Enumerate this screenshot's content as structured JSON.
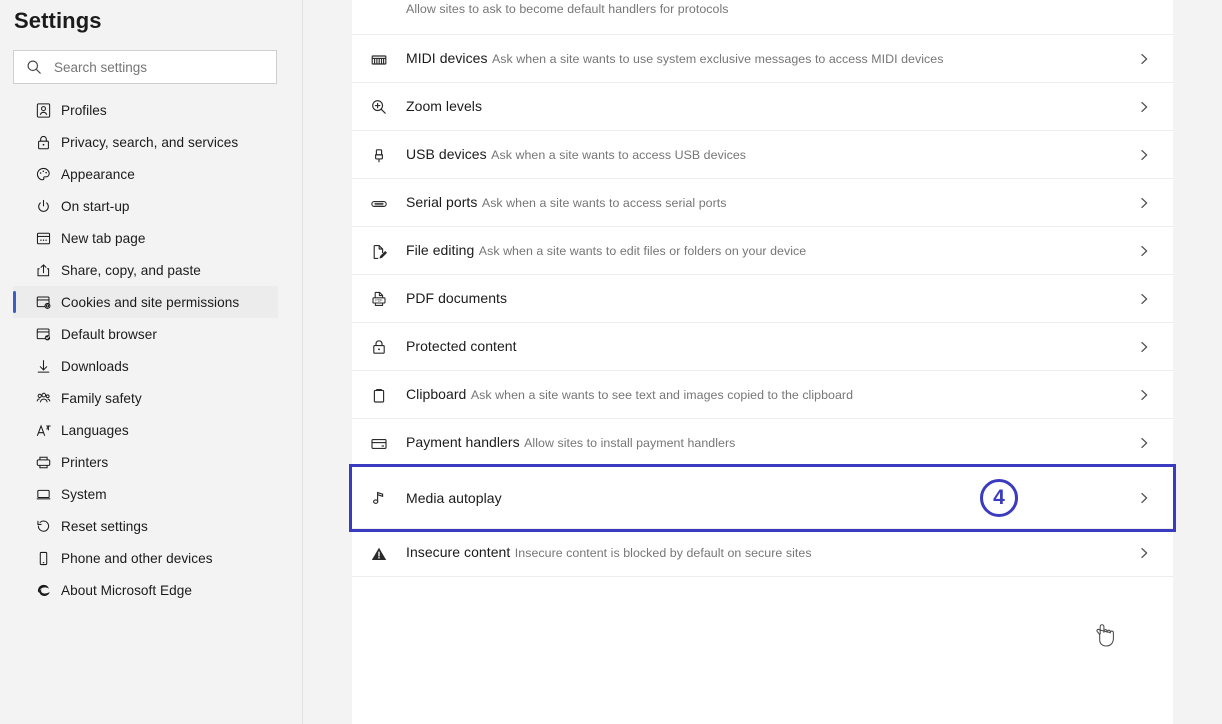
{
  "sidebar": {
    "title": "Settings",
    "search": {
      "placeholder": "Search settings",
      "value": "",
      "icon": "search-icon"
    },
    "items": [
      {
        "label": "Profiles",
        "icon": "profile-icon",
        "selected": false
      },
      {
        "label": "Privacy, search, and services",
        "icon": "lock-icon",
        "selected": false
      },
      {
        "label": "Appearance",
        "icon": "palette-icon",
        "selected": false
      },
      {
        "label": "On start-up",
        "icon": "power-icon",
        "selected": false
      },
      {
        "label": "New tab page",
        "icon": "new-tab-icon",
        "selected": false
      },
      {
        "label": "Share, copy, and paste",
        "icon": "share-icon",
        "selected": false
      },
      {
        "label": "Cookies and site permissions",
        "icon": "cookies-icon",
        "selected": true
      },
      {
        "label": "Default browser",
        "icon": "default-browser-icon",
        "selected": false
      },
      {
        "label": "Downloads",
        "icon": "download-icon",
        "selected": false
      },
      {
        "label": "Family safety",
        "icon": "family-icon",
        "selected": false
      },
      {
        "label": "Languages",
        "icon": "languages-icon",
        "selected": false
      },
      {
        "label": "Printers",
        "icon": "printer-icon",
        "selected": false
      },
      {
        "label": "System",
        "icon": "system-icon",
        "selected": false
      },
      {
        "label": "Reset settings",
        "icon": "reset-icon",
        "selected": false
      },
      {
        "label": "Phone and other devices",
        "icon": "phone-icon",
        "selected": false
      },
      {
        "label": "About Microsoft Edge",
        "icon": "edge-logo-icon",
        "selected": false
      }
    ]
  },
  "main": {
    "rows": [
      {
        "title": "",
        "subtitle": "Allow sites to ask to become default handlers for protocols",
        "icon": "protocol-handlers-icon",
        "chevron": false,
        "partial": true,
        "highlighted": false
      },
      {
        "title": "MIDI devices",
        "subtitle": "Ask when a site wants to use system exclusive messages to access MIDI devices",
        "icon": "midi-keyboard-icon",
        "chevron": true,
        "partial": false,
        "highlighted": false
      },
      {
        "title": "Zoom levels",
        "subtitle": "",
        "icon": "zoom-in-icon",
        "chevron": true,
        "partial": false,
        "highlighted": false
      },
      {
        "title": "USB devices",
        "subtitle": "Ask when a site wants to access USB devices",
        "icon": "usb-icon",
        "chevron": true,
        "partial": false,
        "highlighted": false
      },
      {
        "title": "Serial ports",
        "subtitle": "Ask when a site wants to access serial ports",
        "icon": "serial-port-icon",
        "chevron": true,
        "partial": false,
        "highlighted": false
      },
      {
        "title": "File editing",
        "subtitle": "Ask when a site wants to edit files or folders on your device",
        "icon": "file-edit-icon",
        "chevron": true,
        "partial": false,
        "highlighted": false
      },
      {
        "title": "PDF documents",
        "subtitle": "",
        "icon": "pdf-document-icon",
        "chevron": true,
        "partial": false,
        "highlighted": false
      },
      {
        "title": "Protected content",
        "subtitle": "",
        "icon": "padlock-icon",
        "chevron": true,
        "partial": false,
        "highlighted": false
      },
      {
        "title": "Clipboard",
        "subtitle": "Ask when a site wants to see text and images copied to the clipboard",
        "icon": "clipboard-icon",
        "chevron": true,
        "partial": false,
        "highlighted": false
      },
      {
        "title": "Payment handlers",
        "subtitle": "Allow sites to install payment handlers",
        "icon": "payment-card-icon",
        "chevron": true,
        "partial": false,
        "highlighted": false
      },
      {
        "title": "Media autoplay",
        "subtitle": "",
        "icon": "music-note-icon",
        "chevron": true,
        "partial": false,
        "highlighted": true,
        "badge": "4"
      },
      {
        "title": "Insecure content",
        "subtitle": "Insecure content is blocked by default on secure sites",
        "icon": "warning-triangle-icon",
        "chevron": true,
        "partial": false,
        "highlighted": false
      }
    ]
  },
  "annotation": {
    "badge_label": "4",
    "highlight_color": "#3b3bbf",
    "cursor": "pointing-hand-cursor"
  },
  "colors": {
    "page_background": "#f3f3f3",
    "card_background": "#ffffff",
    "accent": "#3b5fc0",
    "annotation": "#3b3bbf",
    "text_primary": "#1b1b1b",
    "text_secondary": "#767676",
    "divider": "#ededed"
  }
}
